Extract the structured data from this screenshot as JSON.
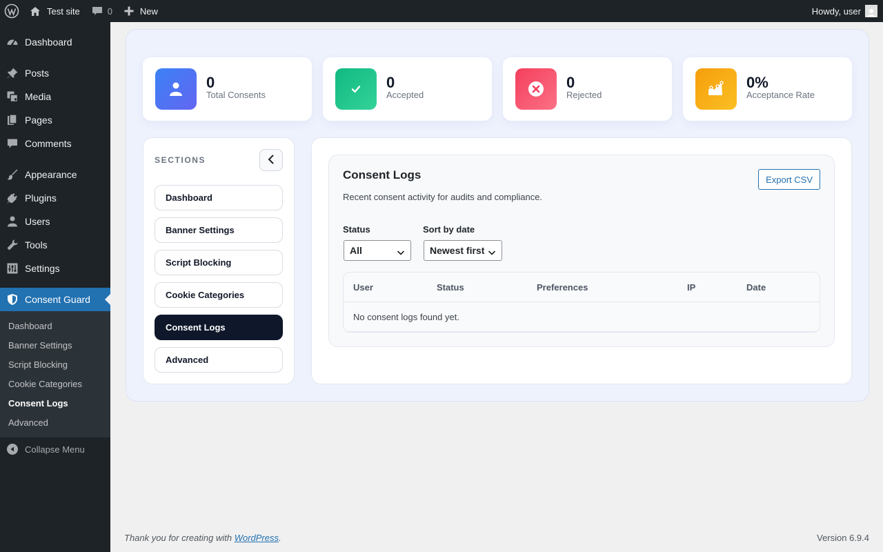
{
  "adminbar": {
    "site_name": "Test site",
    "comments_count": "0",
    "new_label": "New",
    "howdy": "Howdy, user"
  },
  "sidebar": {
    "items": [
      {
        "label": "Dashboard",
        "icon": "dashboard-icon"
      },
      {
        "label": "Posts",
        "icon": "pin-icon"
      },
      {
        "label": "Media",
        "icon": "media-icon"
      },
      {
        "label": "Pages",
        "icon": "pages-icon"
      },
      {
        "label": "Comments",
        "icon": "comment-icon"
      },
      {
        "label": "Appearance",
        "icon": "brush-icon"
      },
      {
        "label": "Plugins",
        "icon": "plug-icon"
      },
      {
        "label": "Users",
        "icon": "user-icon"
      },
      {
        "label": "Tools",
        "icon": "wrench-icon"
      },
      {
        "label": "Settings",
        "icon": "sliders-icon"
      },
      {
        "label": "Consent Guard",
        "icon": "shield-icon"
      }
    ],
    "submenu": [
      "Dashboard",
      "Banner Settings",
      "Script Blocking",
      "Cookie Categories",
      "Consent Logs",
      "Advanced"
    ],
    "collapse_label": "Collapse Menu"
  },
  "stats": [
    {
      "value": "0",
      "label": "Total Consents",
      "color_from": "#3b82f6",
      "color_to": "#6366f1"
    },
    {
      "value": "0",
      "label": "Accepted",
      "color_from": "#10b981",
      "color_to": "#34d399"
    },
    {
      "value": "0",
      "label": "Rejected",
      "color_from": "#f43f5e",
      "color_to": "#fb7185"
    },
    {
      "value": "0%",
      "label": "Acceptance Rate",
      "color_from": "#f59e0b",
      "color_to": "#fbbf24"
    }
  ],
  "sections": {
    "title": "SECTIONS",
    "items": [
      "Dashboard",
      "Banner Settings",
      "Script Blocking",
      "Cookie Categories",
      "Consent Logs",
      "Advanced"
    ],
    "active": "Consent Logs"
  },
  "panel": {
    "title": "Consent Logs",
    "description": "Recent consent activity for audits and compliance.",
    "export_label": "Export CSV",
    "filters": {
      "status_label": "Status",
      "status_value": "All",
      "sort_label": "Sort by date",
      "sort_value": "Newest first"
    },
    "table": {
      "columns": [
        "User",
        "Status",
        "Preferences",
        "IP",
        "Date"
      ],
      "empty_message": "No consent logs found yet."
    }
  },
  "footer": {
    "thanks_prefix": "Thank you for creating with ",
    "thanks_link": "WordPress",
    "thanks_suffix": ".",
    "version": "Version 6.9.4"
  }
}
